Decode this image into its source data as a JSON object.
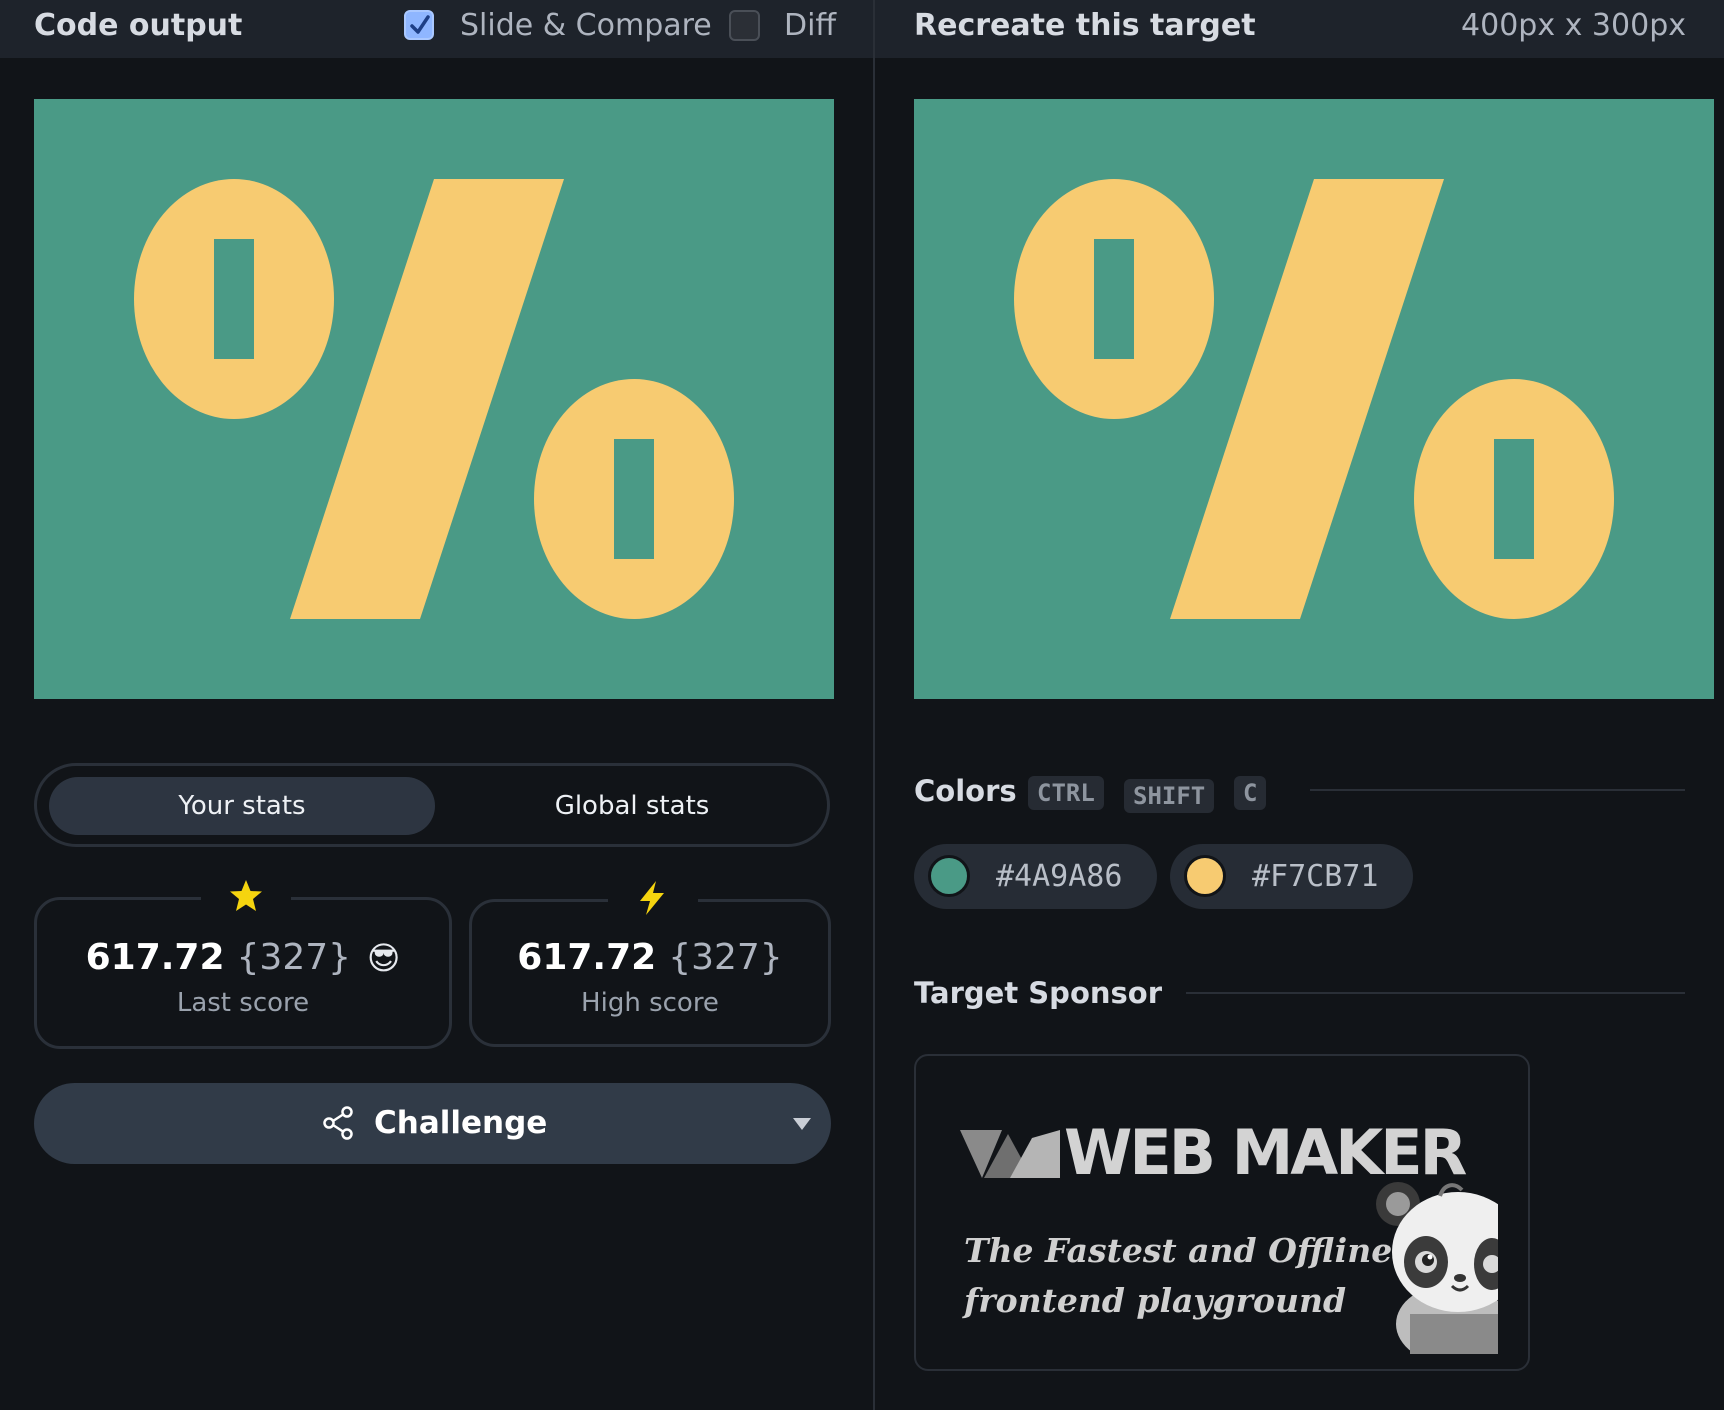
{
  "toolbar": {
    "left_title": "Code output",
    "slide_compare_label": "Slide & Compare",
    "slide_compare_checked": true,
    "diff_label": "Diff",
    "diff_checked": false,
    "right_title": "Recreate this target",
    "dimensions": "400px x 300px"
  },
  "canvas": {
    "background": "#4A9A86",
    "shape_color": "#F7CB71"
  },
  "stats": {
    "tabs": [
      "Your stats",
      "Global stats"
    ],
    "active_tab": "Your stats",
    "last": {
      "score": "617.72",
      "count": "{327}",
      "emoji": "😎",
      "label": "Last score",
      "icon": "star-icon"
    },
    "high": {
      "score": "617.72",
      "count": "{327}",
      "label": "High score",
      "icon": "lightning-icon"
    }
  },
  "challenge": {
    "label": "Challenge",
    "icon": "share-icon"
  },
  "colors": {
    "title": "Colors",
    "shortcut": [
      "CTRL",
      "SHIFT",
      "C"
    ],
    "swatches": [
      {
        "hex": "#4A9A86"
      },
      {
        "hex": "#F7CB71"
      }
    ]
  },
  "sponsor": {
    "title": "Target Sponsor",
    "logo_text": "WEB MAKER",
    "tagline_1": "The Fastest and Offline",
    "tagline_2": "frontend playground"
  }
}
